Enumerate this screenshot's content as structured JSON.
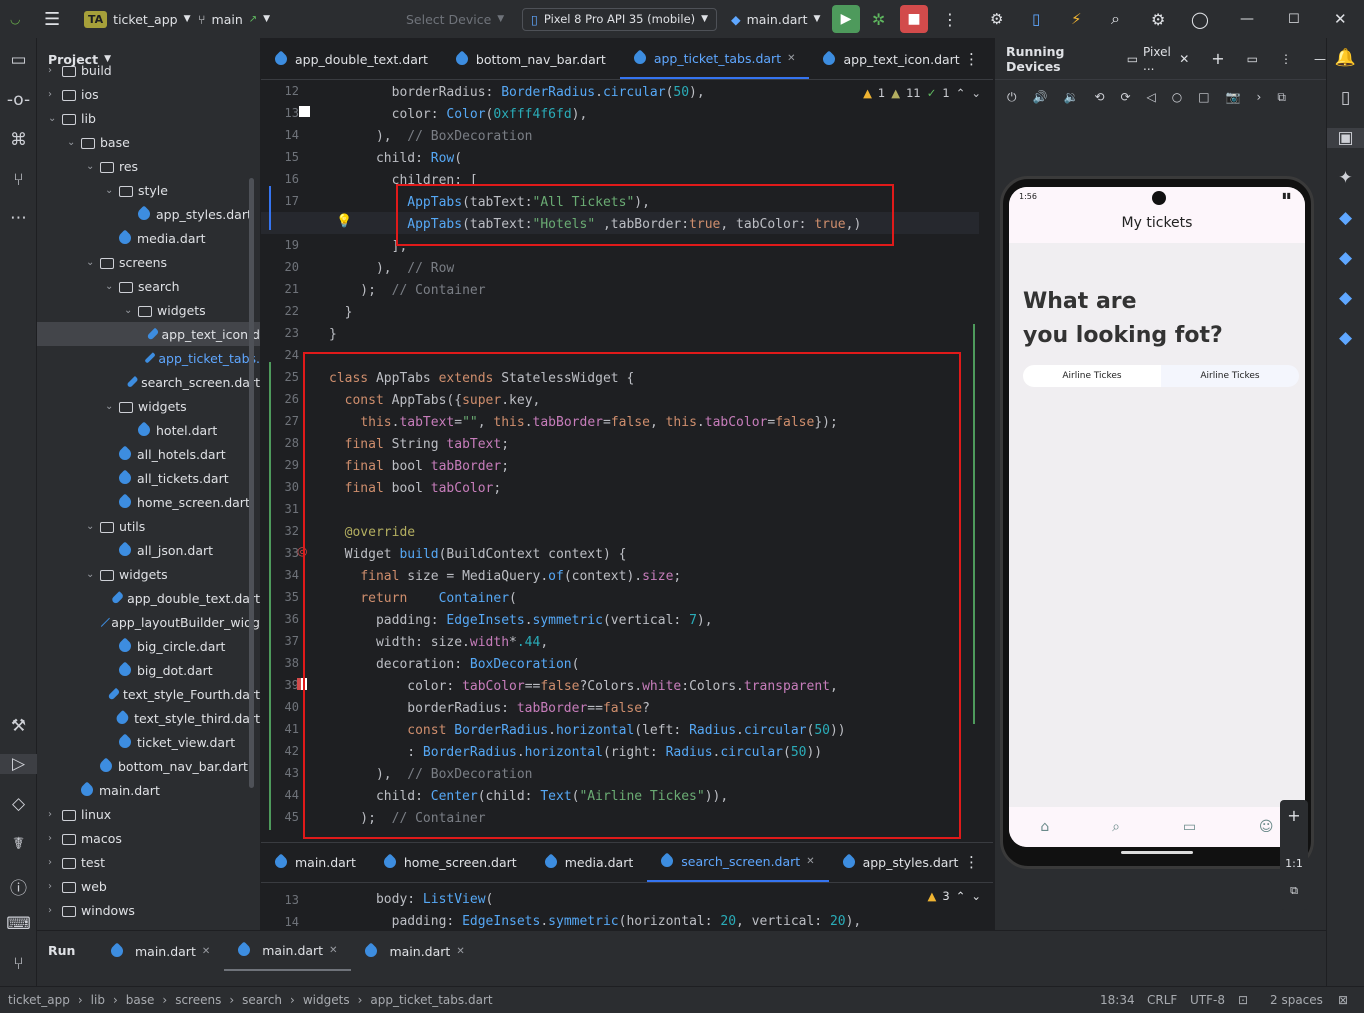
{
  "toolbar": {
    "project_badge": "TA",
    "project_name": "ticket_app",
    "branch": "main",
    "select_device": "Select Device",
    "device": "Pixel 8 Pro API 35 (mobile)",
    "run_config": "main.dart"
  },
  "project_panel": {
    "title": "Project"
  },
  "tree": [
    {
      "label": "build",
      "indent": 1,
      "kind": "folder",
      "arrow": ">"
    },
    {
      "label": "ios",
      "indent": 1,
      "kind": "folder",
      "arrow": ">"
    },
    {
      "label": "lib",
      "indent": 1,
      "kind": "folder",
      "arrow": "v"
    },
    {
      "label": "base",
      "indent": 2,
      "kind": "folder",
      "arrow": "v"
    },
    {
      "label": "res",
      "indent": 3,
      "kind": "folder",
      "arrow": "v"
    },
    {
      "label": "style",
      "indent": 4,
      "kind": "folder",
      "arrow": "v"
    },
    {
      "label": "app_styles.dart",
      "indent": 5,
      "kind": "dart"
    },
    {
      "label": "media.dart",
      "indent": 4,
      "kind": "dart"
    },
    {
      "label": "screens",
      "indent": 3,
      "kind": "folder",
      "arrow": "v"
    },
    {
      "label": "search",
      "indent": 4,
      "kind": "folder",
      "arrow": "v"
    },
    {
      "label": "widgets",
      "indent": 5,
      "kind": "folder",
      "arrow": "v"
    },
    {
      "label": "app_text_icon.d",
      "indent": 6,
      "kind": "dart",
      "selected": true
    },
    {
      "label": "app_ticket_tabs.",
      "indent": 6,
      "kind": "dart",
      "active": true
    },
    {
      "label": "search_screen.dart",
      "indent": 5,
      "kind": "dart"
    },
    {
      "label": "widgets",
      "indent": 4,
      "kind": "folder",
      "arrow": "v"
    },
    {
      "label": "hotel.dart",
      "indent": 5,
      "kind": "dart"
    },
    {
      "label": "all_hotels.dart",
      "indent": 4,
      "kind": "dart"
    },
    {
      "label": "all_tickets.dart",
      "indent": 4,
      "kind": "dart"
    },
    {
      "label": "home_screen.dart",
      "indent": 4,
      "kind": "dart"
    },
    {
      "label": "utils",
      "indent": 3,
      "kind": "folder",
      "arrow": "v"
    },
    {
      "label": "all_json.dart",
      "indent": 4,
      "kind": "dart"
    },
    {
      "label": "widgets",
      "indent": 3,
      "kind": "folder",
      "arrow": "v"
    },
    {
      "label": "app_double_text.dart",
      "indent": 4,
      "kind": "dart"
    },
    {
      "label": "app_layoutBuilder_widg",
      "indent": 4,
      "kind": "dart"
    },
    {
      "label": "big_circle.dart",
      "indent": 4,
      "kind": "dart"
    },
    {
      "label": "big_dot.dart",
      "indent": 4,
      "kind": "dart"
    },
    {
      "label": "text_style_Fourth.dart",
      "indent": 4,
      "kind": "dart"
    },
    {
      "label": "text_style_third.dart",
      "indent": 4,
      "kind": "dart"
    },
    {
      "label": "ticket_view.dart",
      "indent": 4,
      "kind": "dart"
    },
    {
      "label": "bottom_nav_bar.dart",
      "indent": 3,
      "kind": "dart"
    },
    {
      "label": "main.dart",
      "indent": 2,
      "kind": "dart"
    },
    {
      "label": "linux",
      "indent": 1,
      "kind": "folder",
      "arrow": ">"
    },
    {
      "label": "macos",
      "indent": 1,
      "kind": "folder",
      "arrow": ">"
    },
    {
      "label": "test",
      "indent": 1,
      "kind": "folder",
      "arrow": ">"
    },
    {
      "label": "web",
      "indent": 1,
      "kind": "folder",
      "arrow": ">"
    },
    {
      "label": "windows",
      "indent": 1,
      "kind": "folder",
      "arrow": ">"
    }
  ],
  "editor_tabs": [
    "app_double_text.dart",
    "bottom_nav_bar.dart",
    "app_ticket_tabs.dart",
    "app_text_icon.dart"
  ],
  "editor_active_tab": "app_ticket_tabs.dart",
  "inspections": {
    "warnings": "1",
    "weak": "11",
    "ok": "1"
  },
  "line_numbers": [
    "12",
    "13",
    "14",
    "15",
    "16",
    "17",
    "18",
    "19",
    "20",
    "21",
    "22",
    "23",
    "24",
    "25",
    "26",
    "27",
    "28",
    "29",
    "30",
    "31",
    "32",
    "33",
    "34",
    "35",
    "36",
    "37",
    "38",
    "39",
    "40",
    "41",
    "42",
    "43",
    "44",
    "45"
  ],
  "bottom_tabs": [
    "main.dart",
    "home_screen.dart",
    "media.dart",
    "search_screen.dart",
    "app_styles.dart"
  ],
  "bottom_active_tab": "search_screen.dart",
  "bottom_inspections": "3",
  "bottom_lines": [
    "13",
    "14"
  ],
  "running_devices": {
    "title": "Running Devices",
    "device_tab": "Pixel ..."
  },
  "phone": {
    "status_time": "1:56",
    "app_title": "My tickets",
    "heading_line1": "What are",
    "heading_line2": "you looking fot?",
    "tab_left": "Airline Tickes",
    "tab_right": "Airline Tickes",
    "zoom": "1:1"
  },
  "run_panel": {
    "label": "Run",
    "tabs": [
      "main.dart",
      "main.dart",
      "main.dart"
    ]
  },
  "statusbar": {
    "crumbs": [
      "ticket_app",
      "lib",
      "base",
      "screens",
      "search",
      "widgets",
      "app_ticket_tabs.dart"
    ],
    "position": "18:34",
    "line_sep": "CRLF",
    "encoding": "UTF-8",
    "indent": "2 spaces"
  }
}
